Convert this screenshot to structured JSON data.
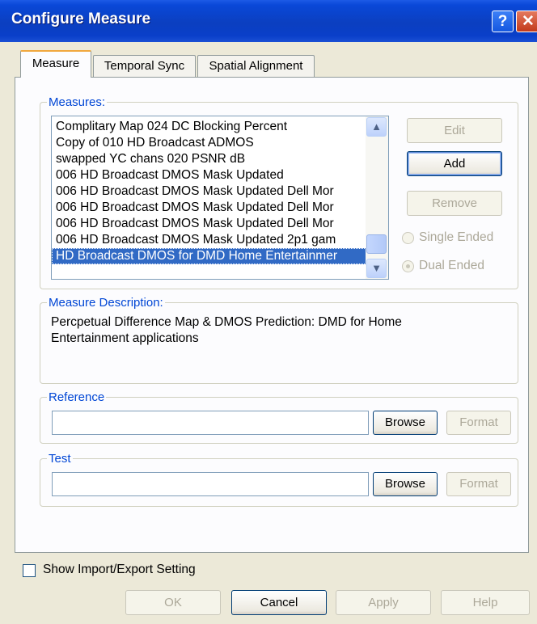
{
  "window": {
    "title": "Configure Measure",
    "help_glyph": "?",
    "close_glyph": "✕"
  },
  "tabs": [
    {
      "label": "Measure",
      "active": true
    },
    {
      "label": "Temporal Sync",
      "active": false
    },
    {
      "label": "Spatial Alignment",
      "active": false
    }
  ],
  "measures": {
    "legend": "Measures:",
    "items": [
      "Complitary Map 024 DC Blocking Percent",
      "Copy of 010 HD Broadcast ADMOS",
      "swapped YC chans 020 PSNR dB",
      "006 HD Broadcast DMOS Mask Updated",
      "006 HD Broadcast DMOS Mask Updated Dell Mor",
      "006 HD Broadcast DMOS Mask Updated Dell Mor",
      "006 HD Broadcast DMOS Mask Updated Dell Mor",
      "006 HD Broadcast DMOS Mask Updated 2p1 gam",
      "HD Broadcast DMOS for DMD Home Entertainmer"
    ],
    "selected_index": 8,
    "edit_label": "Edit",
    "add_label": "Add",
    "remove_label": "Remove",
    "single_ended_label": "Single Ended",
    "dual_ended_label": "Dual Ended"
  },
  "description": {
    "legend": "Measure Description:",
    "line1": "Percpetual  Difference Map & DMOS Prediction: DMD for Home",
    "line2": "Entertainment applications"
  },
  "reference": {
    "legend": "Reference",
    "value": "",
    "browse_label": "Browse",
    "format_label": "Format"
  },
  "test": {
    "legend": "Test",
    "value": "",
    "browse_label": "Browse",
    "format_label": "Format"
  },
  "footer": {
    "show_import_export_label": "Show Import/Export Setting",
    "show_import_export_checked": false,
    "ok_label": "OK",
    "cancel_label": "Cancel",
    "apply_label": "Apply",
    "help_label": "Help"
  }
}
